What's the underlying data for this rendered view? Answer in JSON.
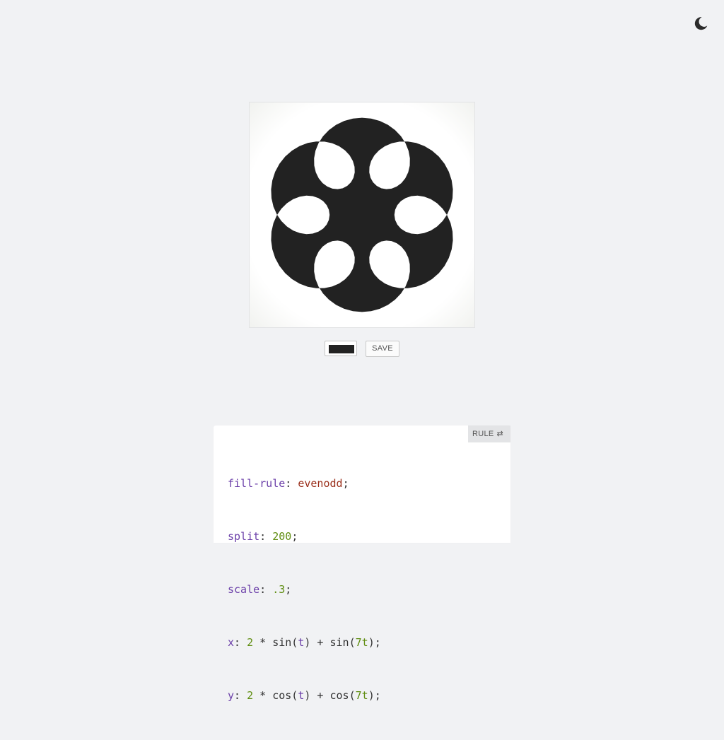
{
  "theme_toggle": {
    "icon": "moon-icon"
  },
  "figure": {
    "color": "#222222",
    "fill_rule": "evenodd",
    "split": 200,
    "scale": 0.3,
    "x_expr": "2 * sin(t) + sin(7t)",
    "y_expr": "2 * cos(t) + cos(7t)"
  },
  "controls": {
    "color_value": "#222222",
    "save_label": "SAVE"
  },
  "editor": {
    "rule_label": "RULE",
    "rule_icon": "swap-arrows-icon",
    "lines": [
      {
        "prop": "fill-rule",
        "value": "evenodd",
        "kind": "str"
      },
      {
        "prop": "split",
        "value": "200",
        "kind": "num"
      },
      {
        "prop": "scale",
        "value": ".3",
        "kind": "num"
      },
      {
        "prop": "x",
        "kind": "expr",
        "tokens": [
          "2",
          " * sin(",
          "t",
          ") + sin(",
          "7t",
          ");"
        ]
      },
      {
        "prop": "y",
        "kind": "expr",
        "tokens": [
          "2",
          " * cos(",
          "t",
          ") + cos(",
          "7t",
          ");"
        ]
      }
    ]
  }
}
